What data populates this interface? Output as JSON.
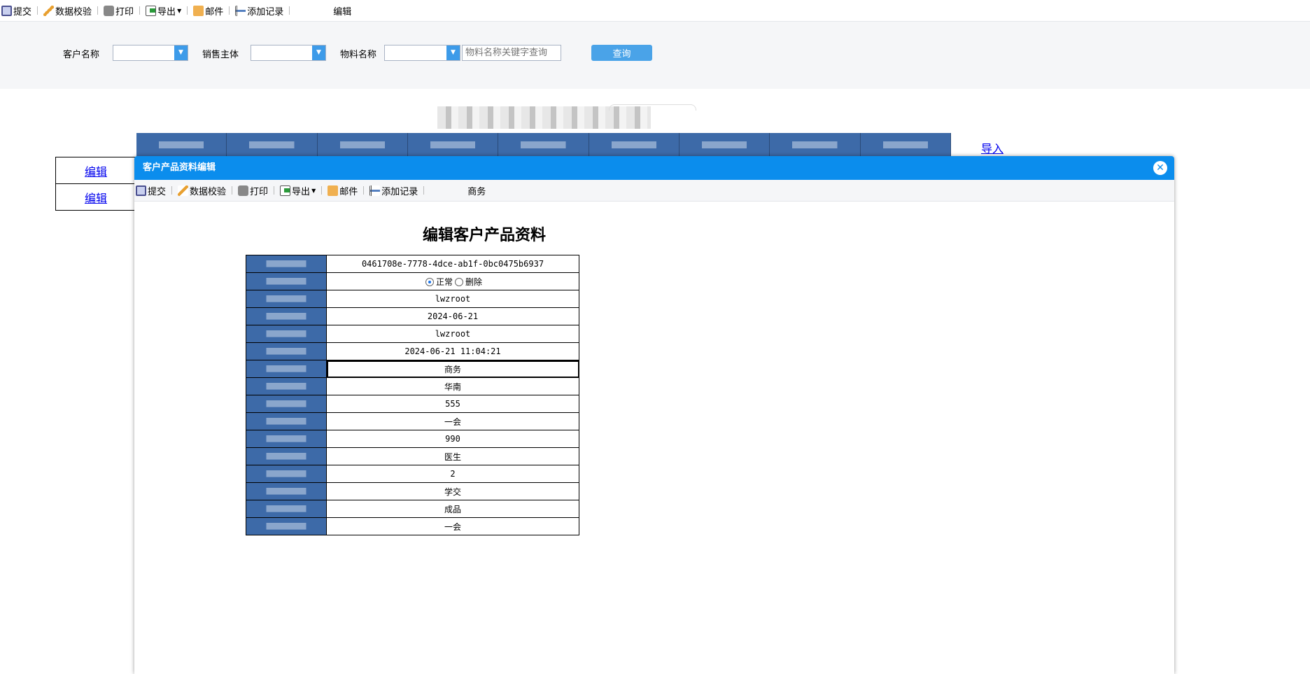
{
  "toolbar": {
    "submit": "提交",
    "validate": "数据校验",
    "print": "打印",
    "export": "导出",
    "mail": "邮件",
    "add_record": "添加记录",
    "context": "编辑"
  },
  "filter": {
    "customer_label": "客户名称",
    "sales_label": "销售主体",
    "material_label": "物料名称",
    "keyword_placeholder": "物料名称关键字查询",
    "query_button": "查询"
  },
  "page": {
    "import_link": "导入",
    "edit_links": [
      "编辑",
      "编辑"
    ]
  },
  "dialog": {
    "title": "客户产品资料编辑",
    "toolbar_context": "商务",
    "form_title": "编辑客户产品资料",
    "rows": [
      "0461708e-7778-4dce-ab1f-0bc0475b6937",
      null,
      "lwzroot",
      "2024-06-21",
      "lwzroot",
      "2024-06-21 11:04:21",
      "商务",
      "华南",
      "555",
      "一会",
      "990",
      "医生",
      "2",
      "学交",
      "成品",
      "一会"
    ],
    "status_options": [
      "正常",
      "删除"
    ],
    "status_selected": "正常"
  }
}
